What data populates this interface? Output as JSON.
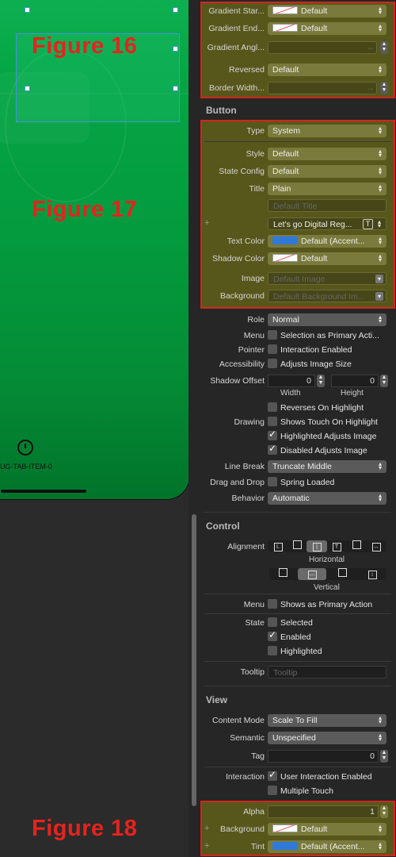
{
  "canvas": {
    "tab_item_label": "UG-TAB-ITEM-0",
    "figures": {
      "fig16": "Figure 16",
      "fig17": "Figure 17",
      "fig18": "Figure 18"
    }
  },
  "inspector": {
    "gradient": {
      "start_label": "Gradient Star...",
      "start_value": "Default",
      "end_label": "Gradient End...",
      "end_value": "Default",
      "angle_label": "Gradient Angl...",
      "angle_value": "--",
      "reversed_label": "Reversed",
      "reversed_value": "Default",
      "border_label": "Border Width...",
      "border_value": "--"
    },
    "button": {
      "section_title": "Button",
      "type_label": "Type",
      "type_value": "System",
      "style_label": "Style",
      "style_value": "Default",
      "state_label": "State Config",
      "state_value": "Default",
      "title_label": "Title",
      "title_value": "Plain",
      "title_placeholder": "Default Title",
      "title_text": "Let's go Digital Reg...",
      "text_color_label": "Text Color",
      "text_color_value": "Default (Accent...",
      "shadow_color_label": "Shadow Color",
      "shadow_color_value": "Default",
      "image_label": "Image",
      "image_placeholder": "Default Image",
      "background_label": "Background",
      "background_placeholder": "Default Background Im...",
      "role_label": "Role",
      "role_value": "Normal",
      "menu_label": "Menu",
      "menu_check": "Selection as Primary Acti...",
      "pointer_label": "Pointer",
      "pointer_check": "Interaction Enabled",
      "access_label": "Accessibility",
      "access_check": "Adjusts Image Size",
      "shadow_offset_label": "Shadow Offset",
      "shadow_width": "0",
      "shadow_height": "0",
      "width_label": "Width",
      "height_label": "Height",
      "reverses_check": "Reverses On Highlight",
      "drawing_label": "Drawing",
      "shows_touch_check": "Shows Touch On Highlight",
      "highlighted_adjusts_check": "Highlighted Adjusts Image",
      "disabled_adjusts_check": "Disabled Adjusts Image",
      "line_break_label": "Line Break",
      "line_break_value": "Truncate Middle",
      "drag_label": "Drag and Drop",
      "drag_check": "Spring Loaded",
      "behavior_label": "Behavior",
      "behavior_value": "Automatic"
    },
    "control": {
      "section_title": "Control",
      "alignment_label": "Alignment",
      "horizontal_label": "Horizontal",
      "vertical_label": "Vertical",
      "menu_label": "Menu",
      "menu_check": "Shows as Primary Action",
      "state_label": "State",
      "selected_check": "Selected",
      "enabled_check": "Enabled",
      "highlighted_check": "Highlighted",
      "tooltip_label": "Tooltip",
      "tooltip_placeholder": "Tooltip"
    },
    "view": {
      "section_title": "View",
      "content_mode_label": "Content Mode",
      "content_mode_value": "Scale To Fill",
      "semantic_label": "Semantic",
      "semantic_value": "Unspecified",
      "tag_label": "Tag",
      "tag_value": "0",
      "interaction_label": "Interaction",
      "interaction_check": "User Interaction Enabled",
      "multiple_touch_check": "Multiple Touch",
      "alpha_label": "Alpha",
      "alpha_value": "1",
      "background_label": "Background",
      "background_value": "Default",
      "tint_label": "Tint",
      "tint_value": "Default (Accent..."
    }
  }
}
